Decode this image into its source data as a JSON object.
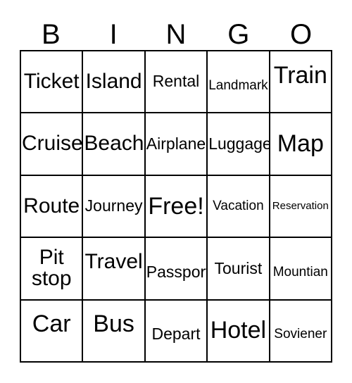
{
  "header": {
    "letters": [
      "B",
      "I",
      "N",
      "G",
      "O"
    ]
  },
  "grid": {
    "rows": [
      [
        {
          "label": "Ticket",
          "size": "fs-lg",
          "valign": "valign-center"
        },
        {
          "label": "Island",
          "size": "fs-lg",
          "valign": "valign-center"
        },
        {
          "label": "Rental",
          "size": "fs-md",
          "valign": "valign-center"
        },
        {
          "label": "Landmark",
          "size": "fs-sm",
          "valign": "valign-low"
        },
        {
          "label": "Train",
          "size": "fs-xl",
          "valign": "valign-high"
        }
      ],
      [
        {
          "label": "Cruise",
          "size": "fs-lg",
          "valign": "valign-center"
        },
        {
          "label": "Beach",
          "size": "fs-lg",
          "valign": "valign-center"
        },
        {
          "label": "Airplane",
          "size": "fs-md",
          "valign": "valign-center"
        },
        {
          "label": "Luggage",
          "size": "fs-md",
          "valign": "valign-center"
        },
        {
          "label": "Map",
          "size": "fs-xl",
          "valign": "valign-center"
        }
      ],
      [
        {
          "label": "Route",
          "size": "fs-lg",
          "valign": "valign-center"
        },
        {
          "label": "Journey",
          "size": "fs-md",
          "valign": "valign-center"
        },
        {
          "label": "Free!",
          "size": "fs-xl",
          "valign": "valign-center"
        },
        {
          "label": "Vacation",
          "size": "fs-sm",
          "valign": "valign-center"
        },
        {
          "label": "Reservation",
          "size": "fs-xs",
          "valign": "valign-center"
        }
      ],
      [
        {
          "label": "Pit stop",
          "size": "fs-lg",
          "valign": "valign-center"
        },
        {
          "label": "Travel",
          "size": "fs-lg",
          "valign": "valign-high"
        },
        {
          "label": "Passport",
          "size": "fs-md",
          "valign": "valign-low"
        },
        {
          "label": "Tourist",
          "size": "fs-md",
          "valign": "valign-center"
        },
        {
          "label": "Mountian",
          "size": "fs-sm",
          "valign": "valign-low"
        }
      ],
      [
        {
          "label": "Car",
          "size": "fs-xl",
          "valign": "valign-high"
        },
        {
          "label": "Bus",
          "size": "fs-xl",
          "valign": "valign-high"
        },
        {
          "label": "Depart",
          "size": "fs-md",
          "valign": "valign-low"
        },
        {
          "label": "Hotel",
          "size": "fs-xl",
          "valign": "valign-center"
        },
        {
          "label": "Soviener",
          "size": "fs-sm",
          "valign": "valign-low"
        }
      ]
    ]
  },
  "colors": {
    "border": "#000000",
    "text": "#000000",
    "background": "#ffffff"
  }
}
